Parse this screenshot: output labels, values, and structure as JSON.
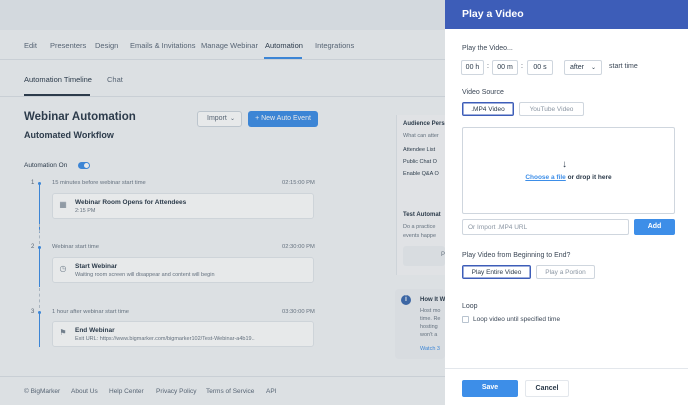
{
  "nav": {
    "tabs": [
      "Edit",
      "Presenters",
      "Design",
      "Emails & Invitations",
      "Manage Webinar",
      "Automation",
      "Integrations"
    ],
    "active": "Automation"
  },
  "subtabs": {
    "timeline": "Automation Timeline",
    "chat": "Chat"
  },
  "main": {
    "title": "Webinar Automation",
    "subtitle": "Automated Workflow",
    "import_label": "Import",
    "new_event_label": "+ New Auto Event",
    "automation_on_label": "Automation On"
  },
  "steps": [
    {
      "num": "1",
      "when": "15 minutes before webinar start time",
      "time": "02:15:00 PM",
      "title": "Webinar Room Opens for Attendees",
      "sub": "2:15 PM",
      "icon": "building-icon"
    },
    {
      "num": "2",
      "when": "Webinar start time",
      "time": "02:30:00 PM",
      "title": "Start Webinar",
      "sub": "Waiting room screen will disappear and content will begin",
      "icon": "clock-icon"
    },
    {
      "num": "3",
      "when": "1 hour after webinar start time",
      "time": "03:30:00 PM",
      "title": "End Webinar",
      "sub": "Exit URL: https://www.bigmarker.com/bigmarker102/Test-Webinar-a4b19..",
      "icon": "flag-icon"
    }
  ],
  "right_panel": {
    "audience_title": "Audience Pers",
    "audience_text": "What can atter",
    "items": [
      "Attendee List",
      "Public Chat O",
      "Enable Q&A O"
    ],
    "test_title": "Test Automat",
    "test_text_1": "Do a practice",
    "test_text_2": "events happe",
    "test_btn": "P",
    "howto_title": "How It W",
    "howto_lines": [
      "Host mo",
      "time. Re",
      "hosting",
      "won't a"
    ],
    "howto_link": "Watch 3"
  },
  "footer": {
    "links": [
      "© BigMarker",
      "About Us",
      "Help Center",
      "Privacy Policy",
      "Terms of Service",
      "API"
    ]
  },
  "modal": {
    "title": "Play a Video",
    "play_the_video_label": "Play the Video...",
    "hours": "00",
    "hours_unit": "h",
    "minutes": "00",
    "minutes_unit": "m",
    "seconds": "00",
    "seconds_unit": "s",
    "relation": "after",
    "start_time_label": "start time",
    "video_source_label": "Video Source",
    "source_mp4": ".MP4 Video",
    "source_youtube": "YouTube Video",
    "choose_file": "Choose a file",
    "drop_rest": " or drop it here",
    "url_placeholder": "Or Import .MP4 URL",
    "add_label": "Add",
    "play_beginning_label": "Play Video from Beginning to End?",
    "play_entire": "Play Entire Video",
    "play_portion": "Play a Portion",
    "loop_label": "Loop",
    "loop_checkbox_label": "Loop video until specified time",
    "save_label": "Save",
    "cancel_label": "Cancel"
  }
}
